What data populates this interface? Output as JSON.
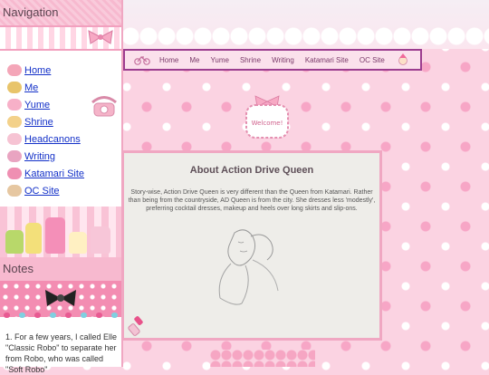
{
  "sidebar": {
    "nav_title": "Navigation",
    "items": [
      {
        "label": "Home",
        "icon": "donut-icon",
        "color": "#f4a6b8"
      },
      {
        "label": "Me",
        "icon": "crown-bag-icon",
        "color": "#e8c46a"
      },
      {
        "label": "Yume",
        "icon": "sweets-icon",
        "color": "#f7b0c8"
      },
      {
        "label": "Shrine",
        "icon": "cake-icon",
        "color": "#f3d18a"
      },
      {
        "label": "Headcanons",
        "icon": "candy-icon",
        "color": "#f6c3d3"
      },
      {
        "label": "Writing",
        "icon": "quill-icon",
        "color": "#e9a4c1"
      },
      {
        "label": "Katamari Site",
        "icon": "flower-icon",
        "color": "#ef8fb2"
      },
      {
        "label": "OC Site",
        "icon": "ribbon-icon",
        "color": "#e6c7a1"
      }
    ],
    "notes_title": "Notes",
    "notes_text": "1. For a few years, I called Elle \"Classic Robo\" to separate her from Robo, who was called \"Soft Robo\""
  },
  "topnav": {
    "items": [
      "Home",
      "Me",
      "Yume",
      "Shrine",
      "Writing",
      "Katamari Site",
      "OC Site"
    ]
  },
  "welcome_text": "Welcome!",
  "content": {
    "title": "About Action Drive Queen",
    "body": "Story-wise, Action Drive Queen is very different than the Queen from Katamari. Rather than being from the countryside, AD Queen is from the city. She dresses less 'modestly', preferring cocktail dresses, makeup and heels over long skirts and slip-ons."
  },
  "colors": {
    "background": "#fbd3e2",
    "accent_pink": "#f0a7c2",
    "nav_border": "#9c3d8f",
    "link_blue": "#1330c8"
  }
}
